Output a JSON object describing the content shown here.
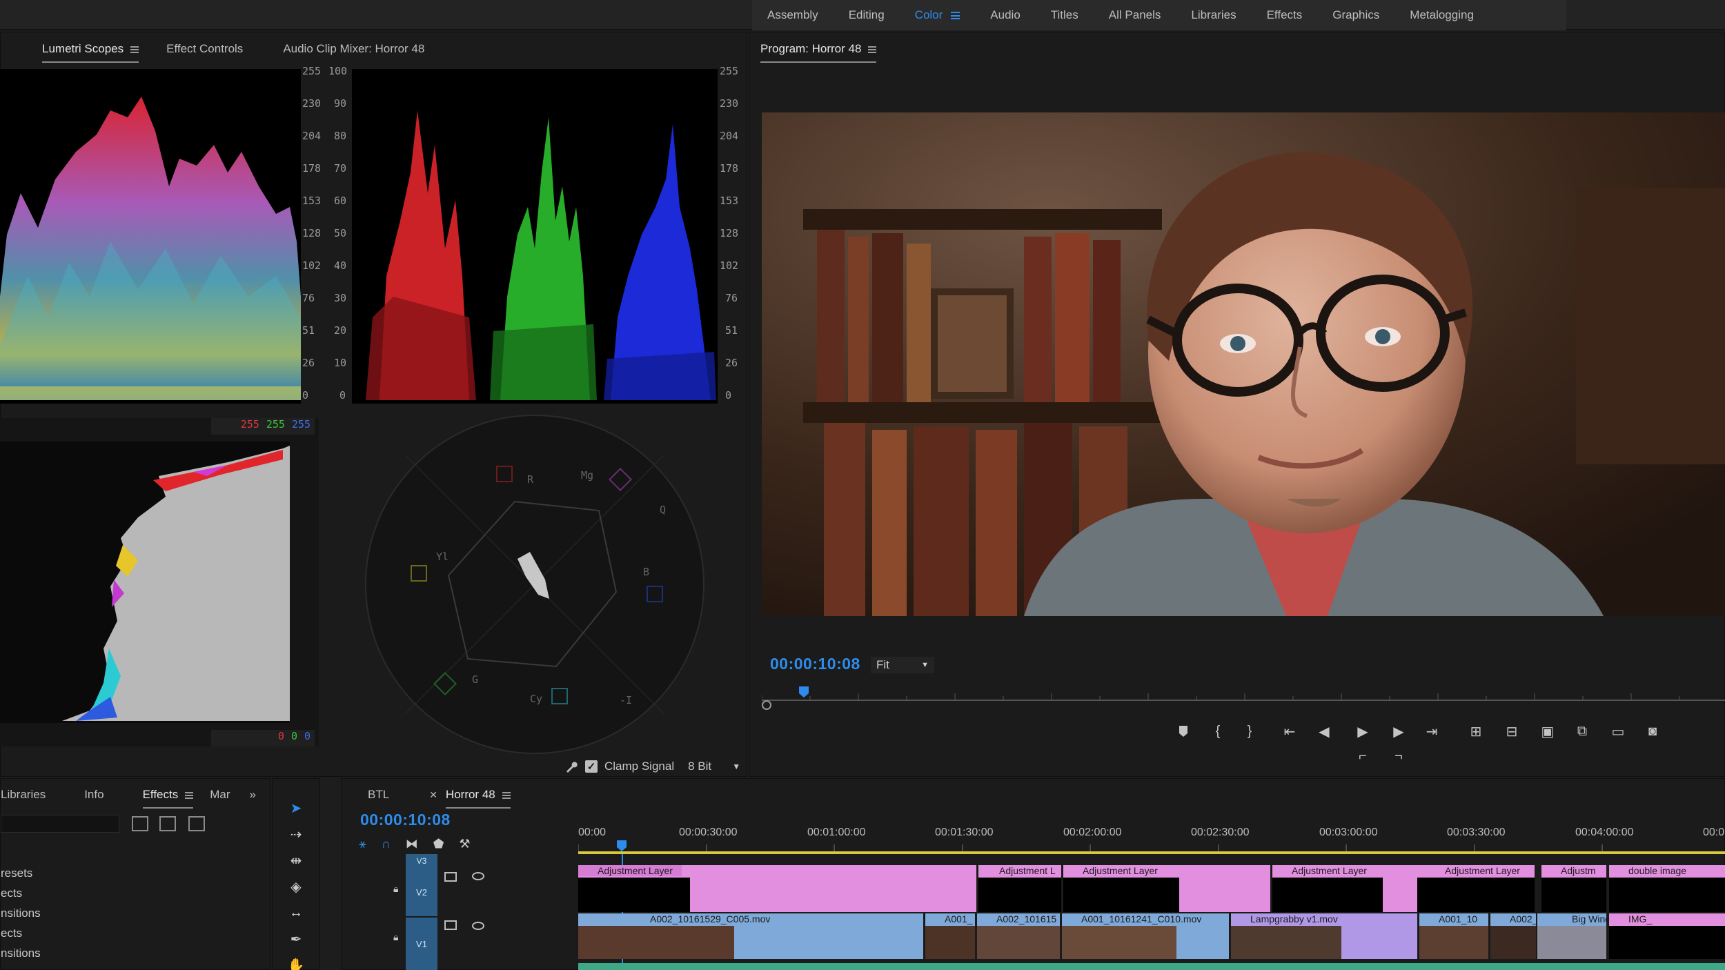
{
  "workspaces": [
    {
      "label": "Assembly",
      "active": false
    },
    {
      "label": "Editing",
      "active": false
    },
    {
      "label": "Color",
      "active": true
    },
    {
      "label": "Audio",
      "active": false
    },
    {
      "label": "Titles",
      "active": false
    },
    {
      "label": "All Panels",
      "active": false
    },
    {
      "label": "Libraries",
      "active": false
    },
    {
      "label": "Effects",
      "active": false
    },
    {
      "label": "Graphics",
      "active": false
    },
    {
      "label": "Metalogging",
      "active": false
    }
  ],
  "source_panel": {
    "tabs": [
      "Lumetri Scopes",
      "Effect Controls",
      "Audio Clip Mixer: Horror 48"
    ],
    "active_tab": "Lumetri Scopes",
    "waveform_scale_8bit": [
      "255",
      "230",
      "204",
      "178",
      "153",
      "128",
      "102",
      "76",
      "51",
      "26",
      "0"
    ],
    "waveform_scale_ire": [
      "100",
      "90",
      "80",
      "70",
      "60",
      "50",
      "40",
      "30",
      "20",
      "10",
      "0"
    ],
    "parade_scale": [
      "255",
      "230",
      "204",
      "178",
      "153",
      "128",
      "102",
      "76",
      "51",
      "26",
      "0"
    ],
    "histogram_top": {
      "r": "255",
      "g": "255",
      "b": "255"
    },
    "histogram_bottom": {
      "r": "0",
      "g": "0",
      "b": "0"
    },
    "vectorscope_labels": {
      "r": "R",
      "mg": "Mg",
      "q": "Q",
      "yl": "Yl",
      "b": "B",
      "g": "G",
      "cy": "Cy",
      "i": "-I"
    },
    "clamp_signal_label": "Clamp Signal",
    "clamp_signal_checked": true,
    "bit_depth": "8 Bit"
  },
  "program_monitor": {
    "title": "Program: Horror 48",
    "timecode": "00:00:10:08",
    "zoom": "Fit"
  },
  "project_panel": {
    "tabs": [
      "Libraries",
      "Info",
      "Effects",
      "Mar"
    ],
    "active_tab": "Effects",
    "items": [
      "resets",
      "ects",
      "nsitions",
      "ects",
      "nsitions"
    ]
  },
  "timeline": {
    "tabs": [
      "BTL",
      "Horror 48"
    ],
    "active_tab": "Horror 48",
    "timecode": "00:00:10:08",
    "ruler": [
      "00:00",
      "00:00:30:00",
      "00:01:00:00",
      "00:01:30:00",
      "00:02:00:00",
      "00:02:30:00",
      "00:03:00:00",
      "00:03:30:00",
      "00:04:00:00",
      "00:0"
    ],
    "tracks": [
      "V3",
      "V2",
      "V1"
    ],
    "v2_clips": [
      {
        "label": "Adjustment Layer"
      },
      {
        "label": "Adjustment L"
      },
      {
        "label": "Adjustment Layer"
      },
      {
        "label": "Adjustment Layer"
      },
      {
        "label": "Adjustment Layer"
      },
      {
        "label": "Adjustm"
      },
      {
        "label": "double image"
      }
    ],
    "v1_clips": [
      {
        "label": "A002_10161529_C005.mov"
      },
      {
        "label": "A001_"
      },
      {
        "label": "A002_101615"
      },
      {
        "label": "A001_10161241_C010.mov"
      },
      {
        "label": "Lampgrabby v1.mov"
      },
      {
        "label": "A001_10"
      },
      {
        "label": "A002_1"
      },
      {
        "label": "Big Wind"
      },
      {
        "label": "IMG_"
      }
    ]
  },
  "colors": {
    "accent": "#2d8ceb",
    "adjustment_clip": "#e38fe0",
    "video_clip": "#7fa9d8",
    "audio_clip": "#3fa889"
  }
}
